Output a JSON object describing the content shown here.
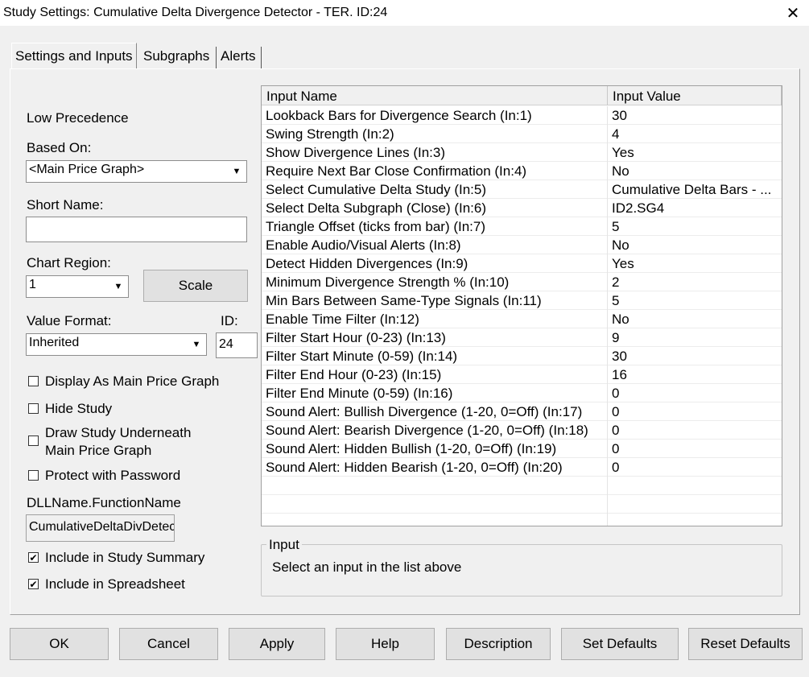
{
  "window": {
    "title": "Study Settings: Cumulative Delta Divergence Detector - TER. ID:24",
    "close_glyph": "✕"
  },
  "tabs": [
    {
      "label": "Settings and Inputs"
    },
    {
      "label": "Subgraphs"
    },
    {
      "label": "Alerts"
    }
  ],
  "left": {
    "precedence": "Low Precedence",
    "based_on_label": "Based On:",
    "based_on_value": "<Main Price Graph>",
    "short_name_label": "Short Name:",
    "short_name_value": "",
    "chart_region_label": "Chart Region:",
    "chart_region_value": "1",
    "scale_button": "Scale",
    "value_format_label": "Value Format:",
    "value_format_value": "Inherited",
    "id_label": "ID:",
    "id_value": "24",
    "checkboxes": [
      {
        "label": "Display As Main Price Graph",
        "checked": false
      },
      {
        "label": "Hide Study",
        "checked": false
      },
      {
        "label": "Draw Study Underneath",
        "label2": "Main Price Graph",
        "checked": false
      },
      {
        "label": "Protect with Password",
        "checked": false
      }
    ],
    "dll_label": "DLLName.FunctionName",
    "dll_value": "CumulativeDeltaDivDetector",
    "include_checkboxes": [
      {
        "label": "Include in Study Summary",
        "checked": true
      },
      {
        "label": "Include in Spreadsheet",
        "checked": true
      }
    ],
    "check_glyph": "✔"
  },
  "inputs_table": {
    "columns": [
      "Input Name",
      "Input Value"
    ],
    "rows": [
      {
        "name": "Lookback Bars for Divergence Search   (In:1)",
        "value": "30"
      },
      {
        "name": "Swing Strength   (In:2)",
        "value": "4"
      },
      {
        "name": "Show Divergence Lines   (In:3)",
        "value": "Yes"
      },
      {
        "name": "Require Next Bar Close Confirmation   (In:4)",
        "value": "No"
      },
      {
        "name": "Select Cumulative Delta Study   (In:5)",
        "value": "Cumulative Delta Bars - ..."
      },
      {
        "name": "Select Delta Subgraph (Close)   (In:6)",
        "value": "ID2.SG4"
      },
      {
        "name": "Triangle Offset (ticks from bar)   (In:7)",
        "value": "5"
      },
      {
        "name": "Enable Audio/Visual Alerts   (In:8)",
        "value": "No"
      },
      {
        "name": "Detect Hidden Divergences   (In:9)",
        "value": "Yes"
      },
      {
        "name": "Minimum Divergence Strength %   (In:10)",
        "value": "2"
      },
      {
        "name": "Min Bars Between Same-Type Signals   (In:11)",
        "value": "5"
      },
      {
        "name": "Enable Time Filter   (In:12)",
        "value": "No"
      },
      {
        "name": "Filter Start Hour (0-23)   (In:13)",
        "value": "9"
      },
      {
        "name": "Filter Start Minute (0-59)   (In:14)",
        "value": "30"
      },
      {
        "name": "Filter End Hour (0-23)   (In:15)",
        "value": "16"
      },
      {
        "name": "Filter End Minute (0-59)   (In:16)",
        "value": "0"
      },
      {
        "name": "Sound Alert: Bullish Divergence (1-20, 0=Off)   (In:17)",
        "value": "0"
      },
      {
        "name": "Sound Alert: Bearish Divergence (1-20, 0=Off)   (In:18)",
        "value": "0"
      },
      {
        "name": "Sound Alert: Hidden Bullish (1-20, 0=Off)   (In:19)",
        "value": "0"
      },
      {
        "name": "Sound Alert: Hidden Bearish (1-20, 0=Off)   (In:20)",
        "value": "0"
      }
    ]
  },
  "input_group": {
    "legend": "Input",
    "description": "Select an input in the list above"
  },
  "buttons": {
    "ok": "OK",
    "cancel": "Cancel",
    "apply": "Apply",
    "help": "Help",
    "description": "Description",
    "set_defaults": "Set Defaults",
    "reset_defaults": "Reset Defaults"
  },
  "icons": {
    "dropdown": "▼"
  }
}
